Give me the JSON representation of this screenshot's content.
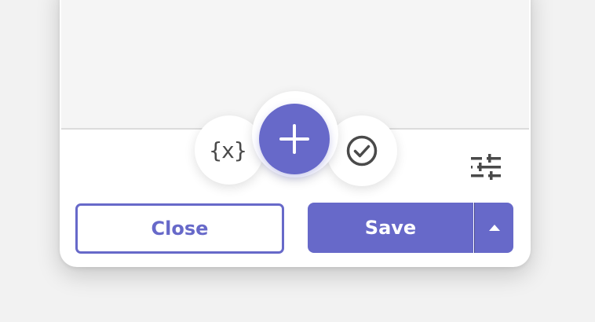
{
  "fabs": {
    "variable_label": "{x}",
    "add_icon": "plus-icon",
    "check_icon": "check-circle-icon"
  },
  "toolbar": {
    "settings_icon": "sliders-icon"
  },
  "actions": {
    "close_label": "Close",
    "save_label": "Save",
    "save_menu_icon": "caret-up-icon"
  },
  "colors": {
    "accent": "#6769c9",
    "icon": "#4a4a4a",
    "editor_bg": "#f5f5f5"
  }
}
